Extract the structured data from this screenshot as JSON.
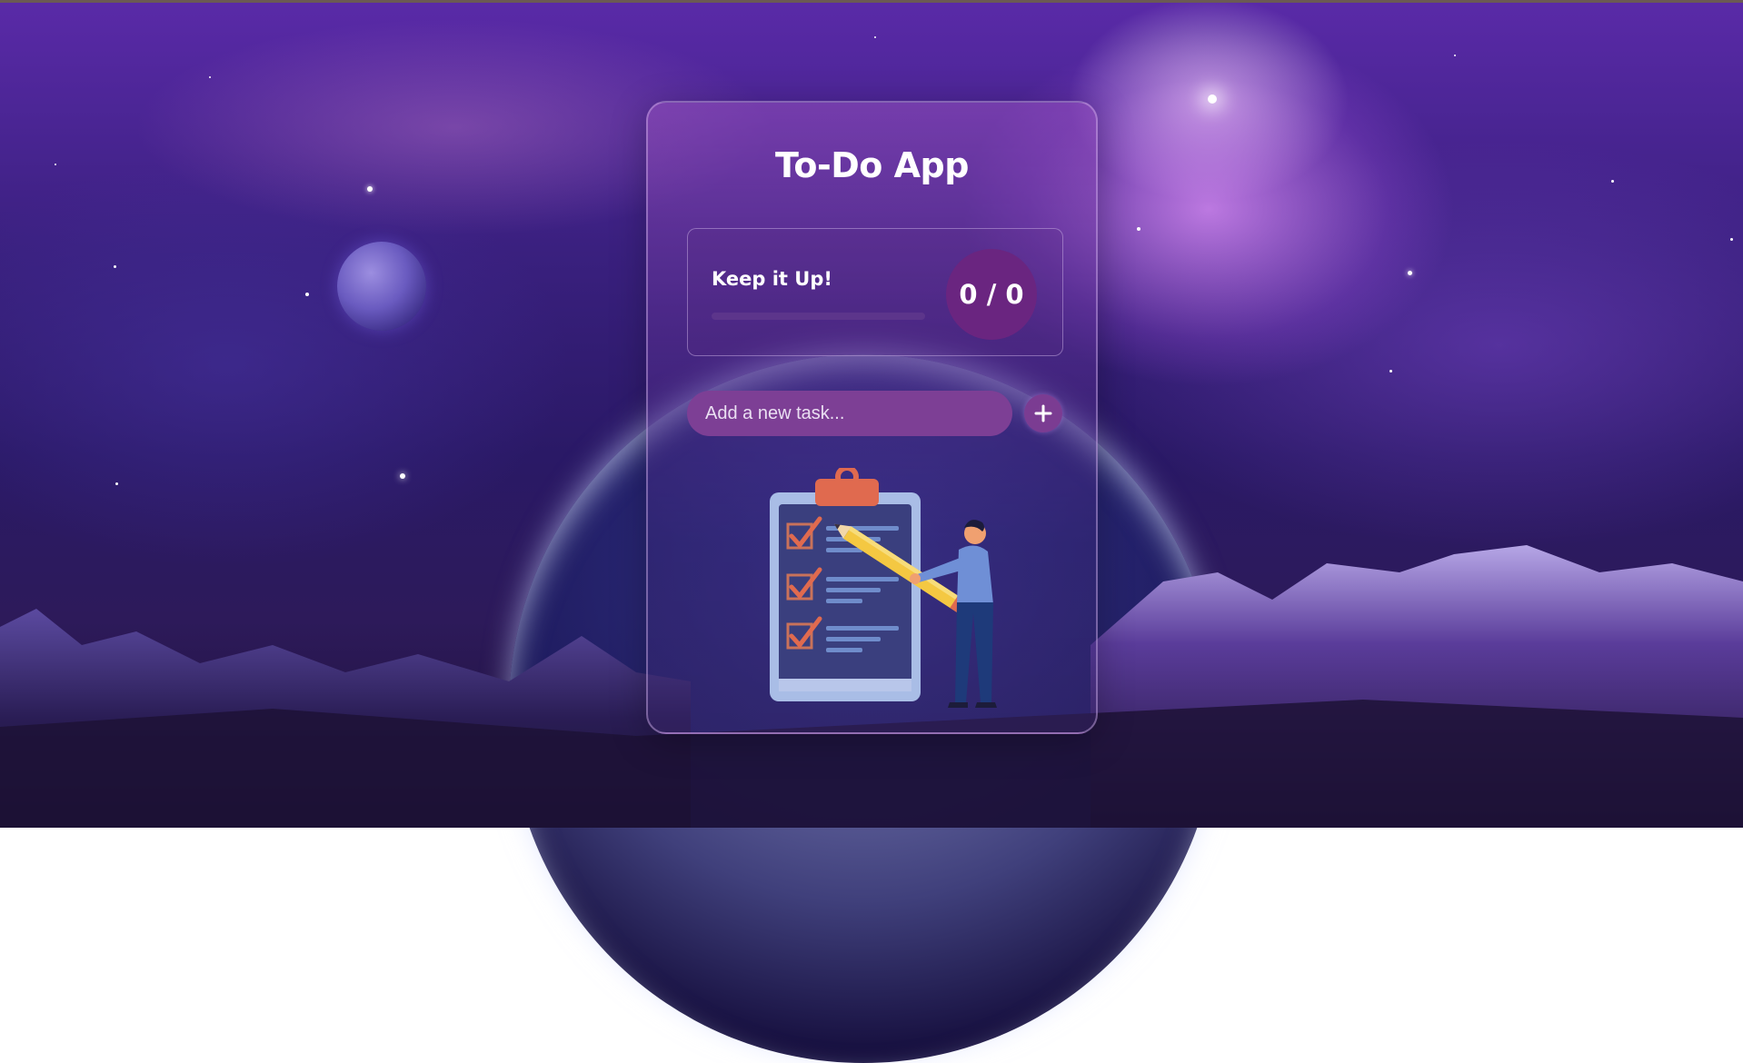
{
  "app": {
    "title": "To-Do App"
  },
  "stats": {
    "message": "Keep it Up!",
    "count_label": "0 / 0",
    "progress_fraction": 0
  },
  "input": {
    "placeholder": "Add a new task...",
    "value": ""
  },
  "icons": {
    "add": "plus-icon",
    "illustration": "checklist-illustration"
  },
  "colors": {
    "accent": "#7d3f95",
    "count_circle": "#6a2580",
    "progress_track": "#5f378c"
  }
}
